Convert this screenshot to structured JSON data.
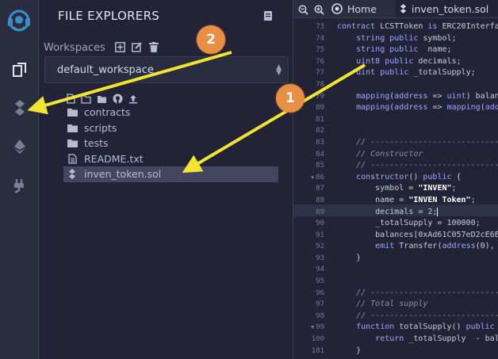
{
  "explorer": {
    "title": "FILE EXPLORERS",
    "workspaces_label": "Workspaces",
    "workspace_selected": "default_workspace",
    "tree": [
      {
        "type": "folder",
        "name": "contracts"
      },
      {
        "type": "folder",
        "name": "scripts"
      },
      {
        "type": "folder",
        "name": "tests"
      },
      {
        "type": "file",
        "name": "README.txt"
      },
      {
        "type": "solidity",
        "name": "inven_token.sol",
        "selected": true
      }
    ]
  },
  "editor": {
    "tab_home": "Home",
    "tab_file": "inven_token.sol",
    "line_numbers": [
      "73",
      "74",
      "75",
      "76",
      "77",
      "78",
      "79",
      "80",
      "81",
      "82",
      "83",
      "84",
      "85",
      "86",
      "87",
      "88",
      "89",
      "90",
      "91",
      "92",
      "93",
      "94",
      "95",
      "96",
      "97",
      "98",
      "99",
      "100",
      "101"
    ]
  },
  "annotations": {
    "badge_1": "1",
    "badge_2": "2"
  },
  "colors": {
    "accent_orange": "#e98f45",
    "arrow_yellow": "#f2e531",
    "bg_dark": "#222336",
    "panel": "#2a2c3f",
    "keyword": "#a3a4f8"
  }
}
